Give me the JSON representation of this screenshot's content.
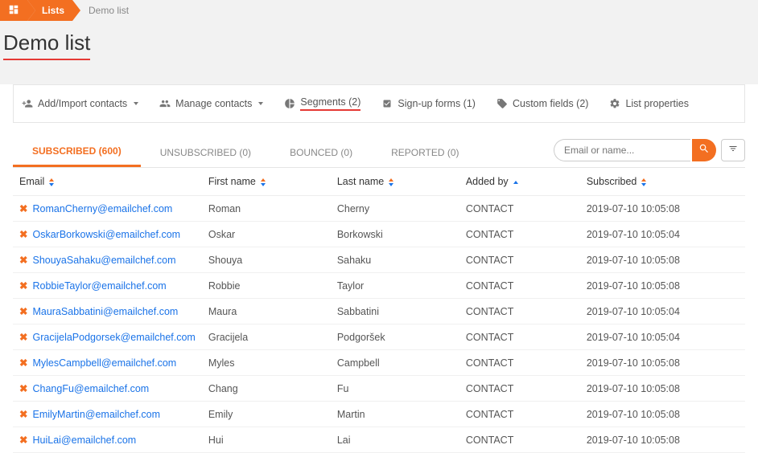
{
  "breadcrumb": {
    "lists": "Lists",
    "current": "Demo list"
  },
  "page_title": "Demo list",
  "toolbar": {
    "add_import": "Add/Import contacts",
    "manage": "Manage contacts",
    "segments": "Segments (2)",
    "signup": "Sign-up forms (1)",
    "custom_fields": "Custom fields (2)",
    "list_props": "List properties"
  },
  "tabs": {
    "subscribed": "SUBSCRIBED (600)",
    "unsubscribed": "UNSUBSCRIBED (0)",
    "bounced": "BOUNCED (0)",
    "reported": "REPORTED (0)"
  },
  "search": {
    "placeholder": "Email or name..."
  },
  "columns": {
    "email": "Email",
    "first_name": "First name",
    "last_name": "Last name",
    "added_by": "Added by",
    "subscribed": "Subscribed"
  },
  "rows": [
    {
      "email": "RomanCherny@emailchef.com",
      "first": "Roman",
      "last": "Cherny",
      "added": "CONTACT",
      "sub": "2019-07-10 10:05:08"
    },
    {
      "email": "OskarBorkowski@emailchef.com",
      "first": "Oskar",
      "last": "Borkowski",
      "added": "CONTACT",
      "sub": "2019-07-10 10:05:04"
    },
    {
      "email": "ShouyaSahaku@emailchef.com",
      "first": "Shouya",
      "last": "Sahaku",
      "added": "CONTACT",
      "sub": "2019-07-10 10:05:08"
    },
    {
      "email": "RobbieTaylor@emailchef.com",
      "first": "Robbie",
      "last": "Taylor",
      "added": "CONTACT",
      "sub": "2019-07-10 10:05:08"
    },
    {
      "email": "MauraSabbatini@emailchef.com",
      "first": "Maura",
      "last": "Sabbatini",
      "added": "CONTACT",
      "sub": "2019-07-10 10:05:04"
    },
    {
      "email": "GracijelaPodgorsek@emailchef.com",
      "first": "Gracijela",
      "last": "Podgoršek",
      "added": "CONTACT",
      "sub": "2019-07-10 10:05:04"
    },
    {
      "email": "MylesCampbell@emailchef.com",
      "first": "Myles",
      "last": "Campbell",
      "added": "CONTACT",
      "sub": "2019-07-10 10:05:08"
    },
    {
      "email": "ChangFu@emailchef.com",
      "first": "Chang",
      "last": "Fu",
      "added": "CONTACT",
      "sub": "2019-07-10 10:05:08"
    },
    {
      "email": "EmilyMartin@emailchef.com",
      "first": "Emily",
      "last": "Martin",
      "added": "CONTACT",
      "sub": "2019-07-10 10:05:08"
    },
    {
      "email": "HuiLai@emailchef.com",
      "first": "Hui",
      "last": "Lai",
      "added": "CONTACT",
      "sub": "2019-07-10 10:05:08"
    }
  ]
}
